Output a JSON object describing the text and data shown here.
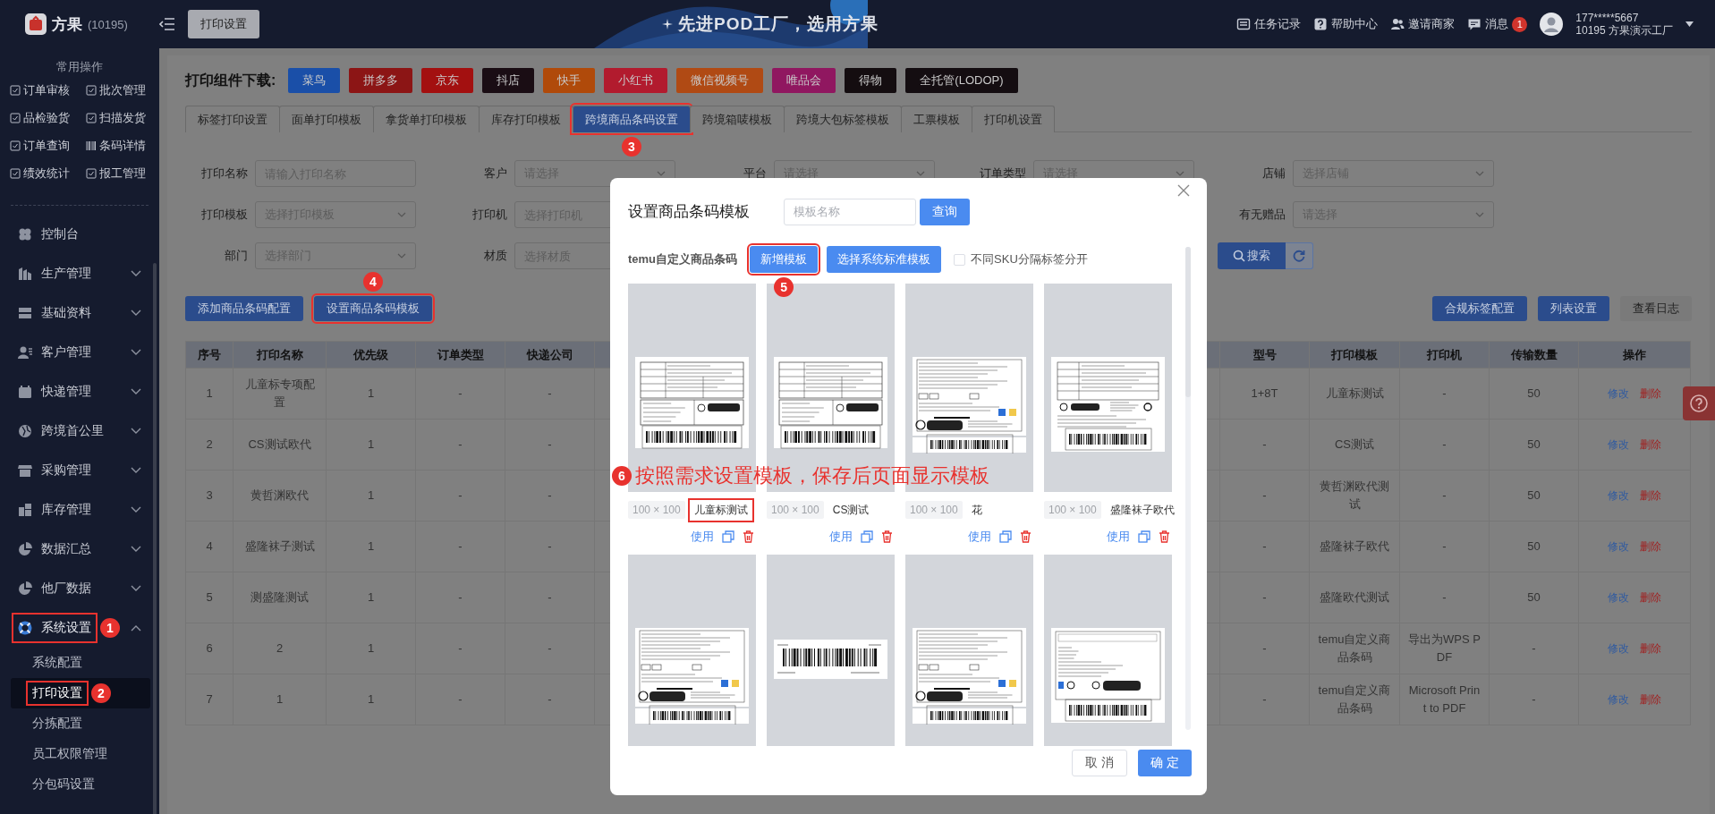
{
  "topbar": {
    "brand": "方果",
    "brand_code": "(10195)",
    "page_button": "打印设置",
    "slogan": "先进POD工厂，选用方果",
    "links": [
      {
        "label": "任务记录"
      },
      {
        "label": "帮助中心"
      },
      {
        "label": "邀请商家"
      },
      {
        "label": "消息",
        "badge": "1"
      }
    ],
    "user": {
      "phone": "177*****5667",
      "company": "10195 方果演示工厂"
    }
  },
  "sidebar": {
    "quick_title": "常用操作",
    "quick_actions": [
      "订单审核",
      "批次管理",
      "品检验货",
      "扫描发货",
      "订单查询",
      "条码详情",
      "绩效统计",
      "报工管理"
    ],
    "menu": [
      {
        "label": "控制台",
        "expandable": false,
        "expanded": false,
        "highlighted": false
      },
      {
        "label": "生产管理",
        "expandable": true,
        "expanded": false,
        "highlighted": false
      },
      {
        "label": "基础资料",
        "expandable": true,
        "expanded": false,
        "highlighted": false
      },
      {
        "label": "客户管理",
        "expandable": true,
        "expanded": false,
        "highlighted": false
      },
      {
        "label": "快递管理",
        "expandable": true,
        "expanded": false,
        "highlighted": false
      },
      {
        "label": "跨境首公里",
        "expandable": true,
        "expanded": false,
        "highlighted": false
      },
      {
        "label": "采购管理",
        "expandable": true,
        "expanded": false,
        "highlighted": false
      },
      {
        "label": "库存管理",
        "expandable": true,
        "expanded": false,
        "highlighted": false
      },
      {
        "label": "数据汇总",
        "expandable": true,
        "expanded": false,
        "highlighted": false
      },
      {
        "label": "他厂数据",
        "expandable": true,
        "expanded": false,
        "highlighted": false
      },
      {
        "label": "系统设置",
        "expandable": true,
        "expanded": true,
        "highlighted": true,
        "marker": "1",
        "children": [
          {
            "label": "系统配置",
            "selected": false,
            "highlighted": false
          },
          {
            "label": "打印设置",
            "selected": true,
            "highlighted": true,
            "marker": "2"
          },
          {
            "label": "分拣配置",
            "selected": false,
            "highlighted": false
          },
          {
            "label": "员工权限管理",
            "selected": false,
            "highlighted": false
          },
          {
            "label": "分包码设置",
            "selected": false,
            "highlighted": false
          }
        ]
      }
    ]
  },
  "downloads": {
    "label": "打印组件下载:",
    "items": [
      {
        "label": "菜鸟",
        "color": "#1a4fa8"
      },
      {
        "label": "拼多多",
        "color": "#8c1515"
      },
      {
        "label": "京东",
        "color": "#a31010"
      },
      {
        "label": "抖店",
        "color": "#1a0d14"
      },
      {
        "label": "快手",
        "color": "#b04a0a"
      },
      {
        "label": "小红书",
        "color": "#b21b2e"
      },
      {
        "label": "微信视频号",
        "color": "#b04a14"
      },
      {
        "label": "唯品会",
        "color": "#901760"
      },
      {
        "label": "得物",
        "color": "#140d10"
      },
      {
        "label": "全托管(LODOP)",
        "color": "#140d11"
      }
    ]
  },
  "tabs": [
    {
      "label": "标签打印设置",
      "selected": false,
      "highlighted": false
    },
    {
      "label": "面单打印模板",
      "selected": false,
      "highlighted": false
    },
    {
      "label": "拿货单打印模板",
      "selected": false,
      "highlighted": false
    },
    {
      "label": "库存打印模板",
      "selected": false,
      "highlighted": false
    },
    {
      "label": "跨境商品条码设置",
      "selected": true,
      "highlighted": true,
      "marker": "3"
    },
    {
      "label": "跨境箱唛模板",
      "selected": false,
      "highlighted": false
    },
    {
      "label": "跨境大包标签模板",
      "selected": false,
      "highlighted": false
    },
    {
      "label": "工票模板",
      "selected": false,
      "highlighted": false
    },
    {
      "label": "打印机设置",
      "selected": false,
      "highlighted": false
    }
  ],
  "filters": {
    "rows": [
      {
        "left": [
          {
            "label": "打印名称",
            "kind": "input",
            "placeholder": "请输入打印名称"
          },
          {
            "label": "客户",
            "kind": "select",
            "placeholder": "请选择"
          },
          {
            "label": "平台",
            "kind": "select",
            "placeholder": "请选择"
          },
          {
            "label": "订单类型",
            "kind": "select",
            "placeholder": "请选择"
          },
          {
            "label": "店铺",
            "kind": "select",
            "placeholder": "选择店铺"
          }
        ]
      },
      {
        "left": [
          {
            "label": "打印模板",
            "kind": "select",
            "placeholder": "选择打印模板"
          },
          {
            "label": "打印机",
            "kind": "input",
            "placeholder": "选择打印机"
          }
        ],
        "right": [
          {
            "label": "有无赠品",
            "kind": "select",
            "placeholder": "请选择"
          }
        ]
      },
      {
        "left": [
          {
            "label": "部门",
            "kind": "select",
            "placeholder": "选择部门"
          },
          {
            "label": "材质",
            "kind": "input",
            "placeholder": "选择材质"
          }
        ]
      }
    ],
    "search_button": "搜索"
  },
  "toolbar": {
    "left": [
      {
        "label": "添加商品条码配置",
        "highlighted": false
      },
      {
        "label": "设置商品条码模板",
        "highlighted": true,
        "marker": "4"
      }
    ],
    "right": [
      {
        "label": "合规标签配置",
        "kind": "primary"
      },
      {
        "label": "列表设置",
        "kind": "primary"
      },
      {
        "label": "查看日志",
        "kind": "plain"
      }
    ]
  },
  "table": {
    "columns": [
      "序号",
      "打印名称",
      "优先级",
      "订单类型",
      "快递公司",
      "型号",
      "打印模板",
      "打印机",
      "传输数量",
      "操作"
    ],
    "rows": [
      {
        "cells": [
          "1",
          "儿童标专项配置",
          "1",
          "-",
          "-",
          "1+8T",
          "儿童标测试",
          "-",
          "50"
        ],
        "actions": [
          {
            "label": "修改",
            "kind": "edit"
          },
          {
            "label": "删除",
            "kind": "delete"
          }
        ]
      },
      {
        "cells": [
          "2",
          "CS测试欧代",
          "1",
          "-",
          "-",
          "-",
          "CS测试",
          "-",
          "50"
        ],
        "actions": [
          {
            "label": "修改",
            "kind": "edit"
          },
          {
            "label": "删除",
            "kind": "delete"
          }
        ]
      },
      {
        "cells": [
          "3",
          "黄哲渊欧代",
          "1",
          "-",
          "-",
          "-",
          "黄哲渊欧代测试",
          "-",
          "50"
        ],
        "actions": [
          {
            "label": "修改",
            "kind": "edit"
          },
          {
            "label": "删除",
            "kind": "delete"
          }
        ]
      },
      {
        "cells": [
          "4",
          "盛隆袜子测试",
          "1",
          "-",
          "-",
          "-",
          "盛隆袜子欧代",
          "-",
          "50"
        ],
        "actions": [
          {
            "label": "修改",
            "kind": "edit"
          },
          {
            "label": "删除",
            "kind": "delete"
          }
        ]
      },
      {
        "cells": [
          "5",
          "测盛隆测试",
          "1",
          "-",
          "-",
          "-",
          "盛隆欧代测试",
          "-",
          "50"
        ],
        "actions": [
          {
            "label": "修改",
            "kind": "edit"
          },
          {
            "label": "删除",
            "kind": "delete"
          }
        ]
      },
      {
        "cells": [
          "6",
          "2",
          "1",
          "-",
          "-",
          "-",
          "temu自定义商品条码",
          "导出为WPS PDF",
          "-"
        ],
        "actions": [
          {
            "label": "修改",
            "kind": "edit"
          },
          {
            "label": "删除",
            "kind": "delete"
          }
        ]
      },
      {
        "cells": [
          "7",
          "1",
          "1",
          "-",
          "-",
          "-",
          "temu自定义商品条码",
          "Microsoft Print to PDF",
          "-"
        ],
        "actions": [
          {
            "label": "修改",
            "kind": "edit"
          },
          {
            "label": "删除",
            "kind": "delete"
          }
        ]
      }
    ]
  },
  "modal": {
    "title": "设置商品条码模板",
    "search_placeholder": "模板名称",
    "search_button": "查询",
    "section_label": "temu自定义商品条码",
    "buttons": [
      {
        "label": "新增模板",
        "highlighted": true,
        "marker": "5"
      },
      {
        "label": "选择系统标准模板",
        "highlighted": false
      }
    ],
    "checkbox": {
      "label": "不同SKU分隔标签分开",
      "checked": false
    },
    "instruction": {
      "marker": "6",
      "text": "按照需求设置模板，保存后页面显示模板"
    },
    "cards": [
      {
        "kind": "warning-table",
        "size": "100 × 100",
        "name": "儿童标测试",
        "highlighted": true,
        "use_label": "使用"
      },
      {
        "kind": "warning-table",
        "size": "100 × 100",
        "name": "CS测试",
        "highlighted": false,
        "use_label": "使用"
      },
      {
        "kind": "made-in-china",
        "size": "100 × 100",
        "name": "花",
        "highlighted": false,
        "use_label": "使用"
      },
      {
        "kind": "compact",
        "size": "100 × 100",
        "name": "盛隆袜子欧代",
        "highlighted": false,
        "use_label": "使用"
      },
      {
        "kind": "made-in-china"
      },
      {
        "kind": "barcode-only"
      },
      {
        "kind": "made-in-china"
      },
      {
        "kind": "blank-form"
      }
    ],
    "footer_buttons": [
      {
        "label": "取 消",
        "kind": "secondary"
      },
      {
        "label": "确 定",
        "kind": "primary"
      }
    ]
  }
}
